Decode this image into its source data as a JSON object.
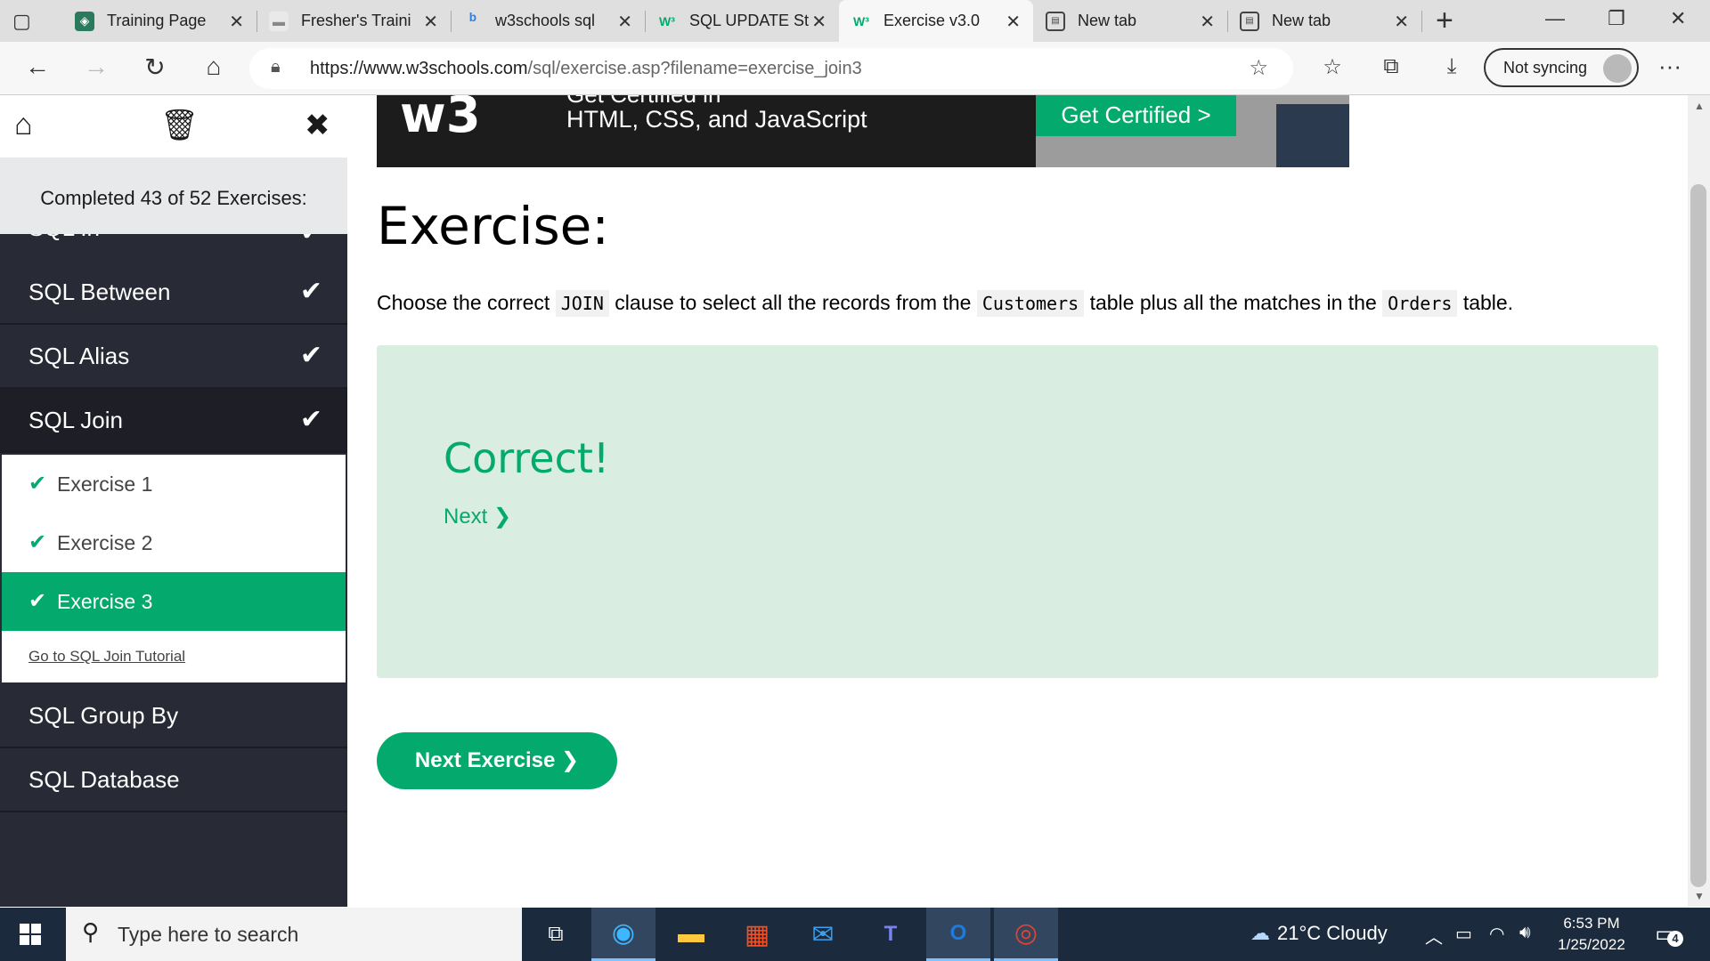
{
  "browser": {
    "tabs": [
      {
        "title": "Training Page",
        "icon": "shield-favicon",
        "color": "#2b7a5e"
      },
      {
        "title": "Fresher's Traini",
        "icon": "page-favicon",
        "color": "#888888"
      },
      {
        "title": "w3schools sql",
        "icon": "bing-favicon",
        "color": "#2f7fe3"
      },
      {
        "title": "SQL UPDATE St",
        "icon": "w3schools-favicon",
        "color": "#04aa6d"
      },
      {
        "title": "Exercise v3.0",
        "icon": "w3schools-favicon",
        "color": "#04aa6d",
        "active": true
      },
      {
        "title": "New tab",
        "icon": "newtab-favicon",
        "color": "#444444"
      },
      {
        "title": "New tab",
        "icon": "newtab-favicon",
        "color": "#444444"
      }
    ],
    "url_host": "https://www.w3schools.com",
    "url_path": "/sql/exercise.asp?filename=exercise_join3",
    "sync_label": "Not syncing"
  },
  "sidebar": {
    "progress": "Completed 43 of 52 Exercises:",
    "clipped_item": "SQL In",
    "items": [
      {
        "label": "SQL Between"
      },
      {
        "label": "SQL Alias"
      },
      {
        "label": "SQL Join"
      }
    ],
    "exercises": [
      {
        "label": "Exercise 1"
      },
      {
        "label": "Exercise 2"
      },
      {
        "label": "Exercise 3"
      }
    ],
    "tutorial_link": "Go to SQL Join Tutorial",
    "after_items": [
      {
        "label": "SQL Group By"
      },
      {
        "label": "SQL Database"
      }
    ]
  },
  "banner": {
    "logo": "w3",
    "line1": "Get Certified in",
    "line2": "HTML, CSS, and JavaScript",
    "cta": "Get Certified >"
  },
  "main": {
    "title": "Exercise:",
    "question": {
      "p1": "Choose the correct",
      "c1": "JOIN",
      "p2": "clause to select all the records from the",
      "c2": "Customers",
      "p3": "table plus all the matches in the",
      "c3": "Orders",
      "p4": "table."
    },
    "result": "Correct!",
    "next_link": "Next ❯",
    "next_exercise": "Next Exercise ❯"
  },
  "taskbar": {
    "search_placeholder": "Type here to search",
    "weather": "21°C  Cloudy",
    "time": "6:53 PM",
    "date": "1/25/2022",
    "notifications": "4"
  },
  "colors": {
    "accent": "#04aa6d",
    "sidebar_bg": "#282a35",
    "answer_bg": "#d9eee1",
    "taskbar_bg": "#1b2a3d"
  }
}
